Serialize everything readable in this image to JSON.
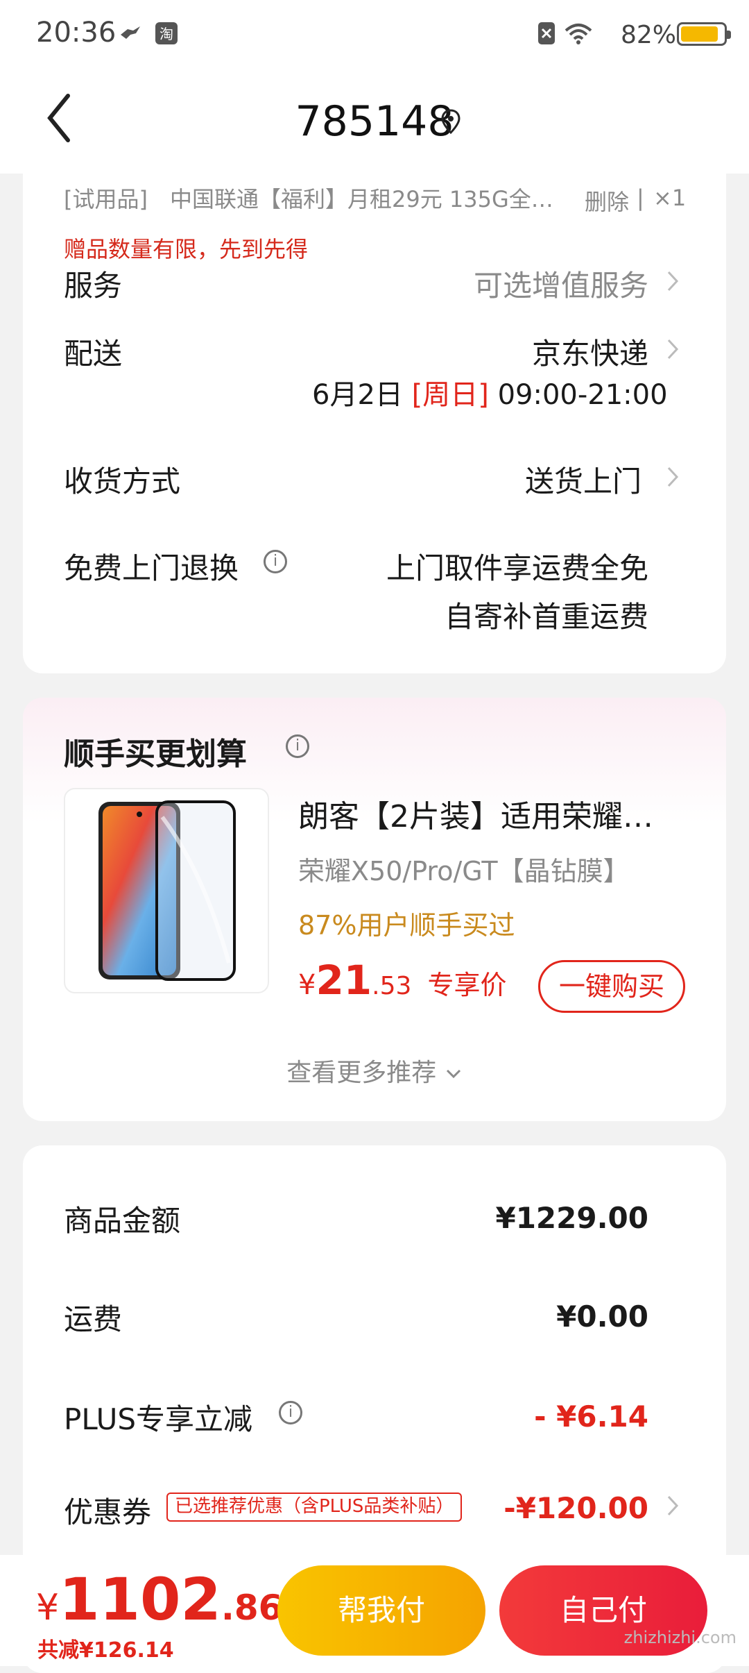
{
  "status_bar": {
    "time": "20:36",
    "battery": "82%",
    "battery_level": 0.82
  },
  "header": {
    "title": "785148"
  },
  "gift_row": {
    "tag": "[试用品]",
    "name": "中国联通【福利】月租29元 135G全…",
    "delete_label": "删除",
    "qty": "×1",
    "warning": "赠品数量有限，先到先得"
  },
  "service": {
    "label": "服务",
    "value": "可选增值服务"
  },
  "delivery": {
    "label": "配送",
    "carrier": "京东快递",
    "date": "6月2日",
    "weekday": "[周日]",
    "time_range": "09:00-21:00"
  },
  "receive": {
    "label": "收货方式",
    "value": "送货上门"
  },
  "free_return": {
    "label": "免费上门退换",
    "line1": "上门取件享运费全免",
    "line2": "自寄补首重运费"
  },
  "recommend": {
    "title": "顺手买更划算",
    "product_title": "朗客【2片装】适用荣耀…",
    "product_subtitle": "荣耀X50/Pro/GT【晶钻膜】",
    "bought": "87%用户顺手买过",
    "price_symbol": "¥",
    "price_int": "21",
    "price_dec": ".53",
    "price_label": "专享价",
    "buy_label": "一键购买",
    "more_label": "查看更多推荐"
  },
  "summary": {
    "goods_label": "商品金额",
    "goods_value": "¥1229.00",
    "shipping_label": "运费",
    "shipping_value": "¥0.00",
    "plus_label": "PLUS专享立减",
    "plus_value": "- ¥6.14",
    "coupon_label": "优惠券",
    "coupon_tag": "已选推荐优惠（含PLUS品类补贴）",
    "coupon_value": "-¥120.00"
  },
  "bottom": {
    "total_symbol": "¥",
    "total_int": "1102",
    "total_dec": ".86",
    "saved": "共减¥126.14",
    "help_pay": "帮我付",
    "self_pay": "自己付"
  },
  "watermark": {
    "text": "zhizhizhi.com"
  },
  "colors": {
    "accent": "#e1251b",
    "orange": "#c98a1e",
    "yellow": "#f7b500"
  }
}
